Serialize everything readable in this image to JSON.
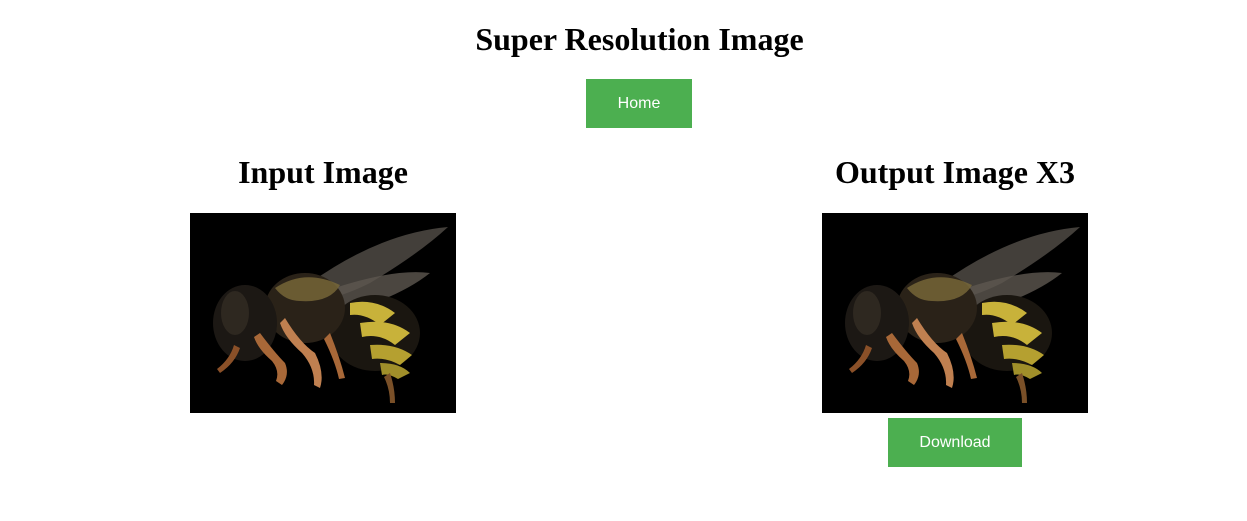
{
  "page": {
    "title": "Super Resolution Image",
    "home_label": "Home"
  },
  "input": {
    "heading": "Input Image",
    "image_subject": "bee"
  },
  "output": {
    "heading": "Output Image X3",
    "image_subject": "bee",
    "download_label": "Download"
  },
  "colors": {
    "button_green": "#4caf50",
    "button_text": "#ffffff",
    "image_background": "#000000"
  }
}
